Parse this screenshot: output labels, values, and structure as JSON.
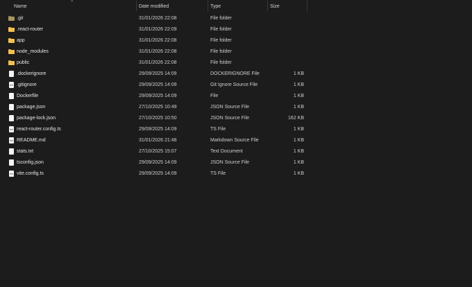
{
  "columns": {
    "name": "Name",
    "date": "Date modified",
    "type": "Type",
    "size": "Size"
  },
  "files": [
    {
      "name": ".git",
      "date": "31/01/2026 22:08",
      "type": "File folder",
      "size": "",
      "icon": "folder-icon-dim"
    },
    {
      "name": ".react-router",
      "date": "31/01/2026 22:09",
      "type": "File folder",
      "size": "",
      "icon": "folder-icon"
    },
    {
      "name": "app",
      "date": "31/01/2026 22:08",
      "type": "File folder",
      "size": "",
      "icon": "folder-icon"
    },
    {
      "name": "node_modules",
      "date": "31/01/2026 22:08",
      "type": "File folder",
      "size": "",
      "icon": "folder-icon"
    },
    {
      "name": "public",
      "date": "31/01/2026 22:08",
      "type": "File folder",
      "size": "",
      "icon": "folder-icon"
    },
    {
      "name": ".dockerignore",
      "date": "29/09/2025 14:09",
      "type": "DOCKERIGNORE File",
      "size": "1 KB",
      "icon": "file-icon"
    },
    {
      "name": ".gitignore",
      "date": "29/09/2025 14:09",
      "type": "Git Ignore Source File",
      "size": "1 KB",
      "icon": "code-file-icon"
    },
    {
      "name": "Dockerfile",
      "date": "29/09/2025 14:09",
      "type": "File",
      "size": "1 KB",
      "icon": "file-icon"
    },
    {
      "name": "package.json",
      "date": "27/10/2025 10:49",
      "type": "JSON Source File",
      "size": "1 KB",
      "icon": "file-icon"
    },
    {
      "name": "package-lock.json",
      "date": "27/10/2025 10:50",
      "type": "JSON Source File",
      "size": "162 KB",
      "icon": "file-icon"
    },
    {
      "name": "react-router.config.ts",
      "date": "29/09/2025 14:09",
      "type": "TS File",
      "size": "1 KB",
      "icon": "code-file-icon"
    },
    {
      "name": "README.md",
      "date": "31/01/2026 21:48",
      "type": "Markdown Source File",
      "size": "1 KB",
      "icon": "code-file-icon"
    },
    {
      "name": "stats.txt",
      "date": "27/10/2025 15:07",
      "type": "Text Document",
      "size": "1 KB",
      "icon": "file-icon"
    },
    {
      "name": "tsconfig.json",
      "date": "29/09/2025 14:09",
      "type": "JSON Source File",
      "size": "1 KB",
      "icon": "file-icon"
    },
    {
      "name": "vite.config.ts",
      "date": "29/09/2025 14:09",
      "type": "TS File",
      "size": "1 KB",
      "icon": "code-file-icon"
    }
  ]
}
